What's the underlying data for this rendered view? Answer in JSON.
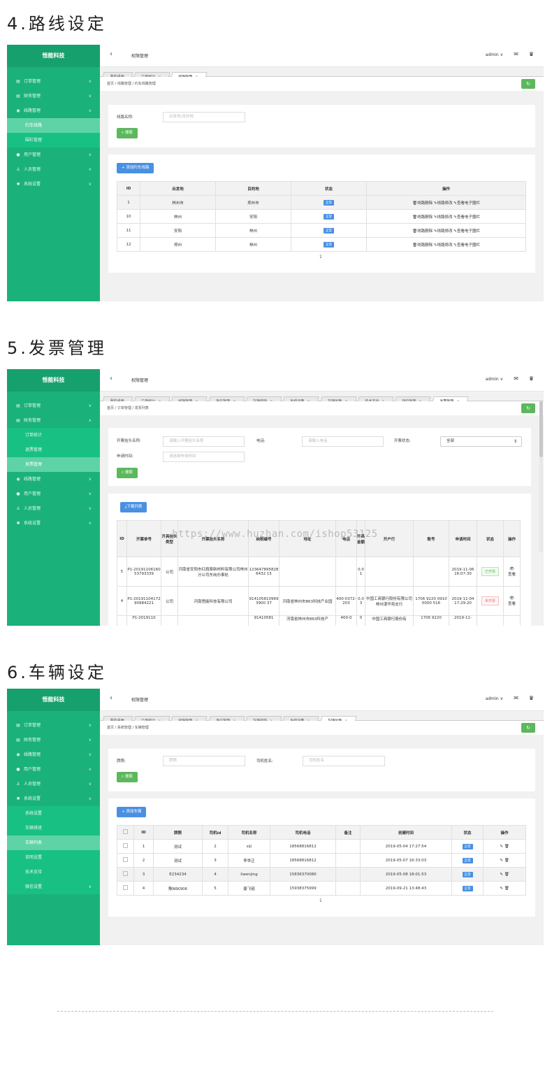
{
  "sections": [
    {
      "title": "4.路线设定"
    },
    {
      "title": "5.发票管理"
    },
    {
      "title": "6.车辆设定"
    }
  ],
  "app": {
    "logo": "悟能科技",
    "header_title": "权限管理",
    "user": "admin ∨",
    "mail_icon": "mail-icon",
    "shirt_icon": "shirt-icon"
  },
  "s1": {
    "sidebar": {
      "items": [
        "订单管理",
        "财务管理",
        "线路管理",
        "约车线路",
        "围栏管理",
        "用户管理",
        "人员管理",
        "系统设置"
      ]
    },
    "tabs": [
      "我的桌面",
      "订单统计",
      "线路管理"
    ],
    "breadcrumb": "首页 / 线路管理 / 约车线路管理",
    "search_label": "线路名称:",
    "search_placeholder": "出发地/目的地",
    "search_btn": "搜索",
    "add_btn": "添加约车线路",
    "headers": [
      "ID",
      "出发地",
      "目的地",
      "状态",
      "操作"
    ],
    "rows": [
      {
        "id": "1",
        "from": "林州市",
        "to": "郑州市",
        "status": "正常",
        "del": "线路删除",
        "edit": "线路修改",
        "view": "查看电子围栏"
      },
      {
        "id": "10",
        "from": "林州",
        "to": "安阳",
        "status": "正常",
        "del": "线路删除",
        "edit": "线路修改",
        "view": "查看电子围栏"
      },
      {
        "id": "11",
        "from": "安阳",
        "to": "林州",
        "status": "正常",
        "del": "线路删除",
        "edit": "线路修改",
        "view": "查看电子围栏"
      },
      {
        "id": "12",
        "from": "郑州",
        "to": "林州",
        "status": "正常",
        "del": "线路删除",
        "edit": "线路修改",
        "view": "查看电子围栏"
      }
    ],
    "page": "1"
  },
  "s2": {
    "sidebar": {
      "items": [
        "订单管理",
        "财务管理",
        "订单统计",
        "退票管理",
        "发票管理",
        "线路管理",
        "用户管理",
        "人员管理",
        "系统设置"
      ]
    },
    "tabs": [
      "我的桌面",
      "订单统计",
      "线路管理",
      "用户管理",
      "车辆排班",
      "系统设置",
      "车辆列表",
      "技术支持",
      "评价管理",
      "发票管理"
    ],
    "breadcrumb": "首页 / 订单管理 / 发票列表",
    "label_title": "开票抬头名称:",
    "ph_title": "请输入开票抬头名称",
    "label_phone": "电话:",
    "ph_phone": "请输入电话",
    "label_state": "开票状态:",
    "state_value": "全部",
    "label_time": "申请时间:",
    "ph_time": "请选择申请时间",
    "search_btn": "搜索",
    "download_btn": "下载列表",
    "headers": [
      "ID",
      "开票单号",
      "开具抬头类型",
      "开票抬头名称",
      "纳税编号",
      "地址",
      "电话",
      "开具金额",
      "开户行",
      "账号",
      "申请时间",
      "状态",
      "操作"
    ],
    "rows": [
      {
        "id": "5",
        "no": "P1-2019110616053793339",
        "type": "公司",
        "name": "河南省安阳市红旗渠新材料有限公司林州分公司东岗办事处",
        "tax": "1236478958286432 15",
        "addr": "",
        "phone": "",
        "amount": "0.01",
        "bank": "",
        "acct": "",
        "time": "2019-11-06 16:07:30",
        "status": "已开票",
        "op": "查看"
      },
      {
        "id": "4",
        "no": "P1-2019110417290984221",
        "type": "公司",
        "name": "河南悟能科技有限公司",
        "tax": "9141058109693900 37",
        "addr": "河南省林州市863科技产业园",
        "phone": "400-0372-203",
        "amount": "0.03",
        "bank": "中国工商银行股份有限公司林州湛华苑支行",
        "acct": "1706 9220 0910 0000 516",
        "time": "2019-11-04 17:29:20",
        "status": "未开票",
        "op": "查看"
      },
      {
        "id": "",
        "no": "P1-2019110",
        "type": "",
        "name": "",
        "tax": "91410581",
        "addr": "河南省林州市863科技产",
        "phone": "400-0",
        "amount": "0",
        "bank": "中国工商银行股份有",
        "acct": "1706 9220",
        "time": "2019-11-",
        "status": "",
        "op": ""
      }
    ],
    "watermark": "https://www.huzhan.com/ishop53125"
  },
  "s3": {
    "sidebar": {
      "items": [
        "订单管理",
        "财务管理",
        "线路管理",
        "用户管理",
        "人员管理",
        "系统设置",
        "系统设置",
        "车辆排班",
        "车辆列表",
        "说明设置",
        "技术支持",
        "微信设置"
      ]
    },
    "tabs": [
      "我的桌面",
      "订单统计",
      "线路管理",
      "用户管理",
      "车辆排班",
      "系统设置",
      "车辆列表"
    ],
    "breadcrumb": "首页 / 系统管理 / 车辆管理",
    "label_plate": "牌照:",
    "ph_plate": "牌照",
    "label_driver": "司机姓名:",
    "ph_driver": "司机姓名",
    "search_btn": "搜索",
    "add_btn": "添加车辆",
    "headers": [
      "ID",
      "牌照",
      "司机id",
      "司机名称",
      "司机电话",
      "备注",
      "创建时间",
      "状态",
      "操作"
    ],
    "rows": [
      {
        "id": "1",
        "plate": "测试",
        "did": "2",
        "dname": "siji",
        "phone": "18568816812",
        "note": "",
        "time": "2019-05-04 17:27:54",
        "status": "正常"
      },
      {
        "id": "2",
        "plate": "测试",
        "did": "3",
        "dname": "李世正",
        "phone": "18568816812",
        "note": "",
        "time": "2019-05-07 16:33:03",
        "status": "正常"
      },
      {
        "id": "3",
        "plate": "E234234",
        "did": "4",
        "dname": "liwenjing",
        "phone": "15836370080",
        "note": "",
        "time": "2019-05-08 18:01:53",
        "status": "正常"
      },
      {
        "id": "4",
        "plate": "豫N6K906",
        "did": "5",
        "dname": "姜飞韬",
        "phone": "15938375999",
        "note": "",
        "time": "2019-09-21 13:48:43",
        "status": "正常"
      }
    ],
    "page": "1"
  }
}
